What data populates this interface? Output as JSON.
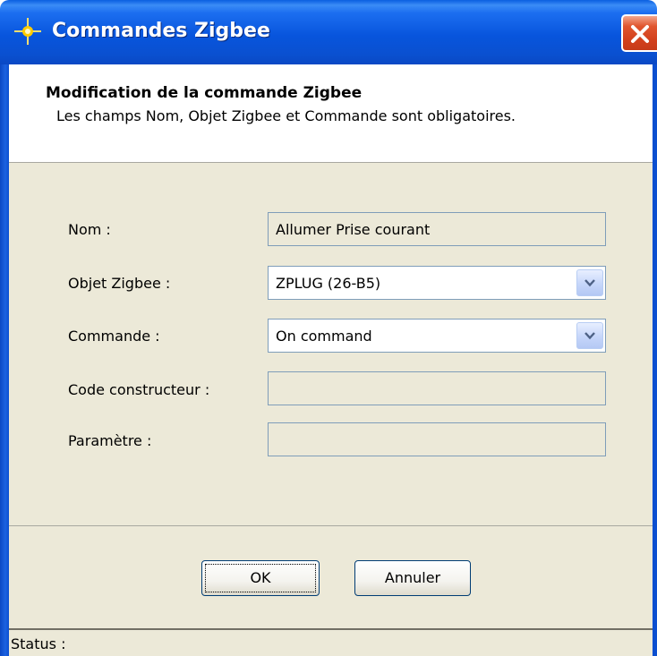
{
  "window": {
    "title": "Commandes Zigbee",
    "icon": "zigbee-star-icon",
    "close_icon": "close-icon"
  },
  "header": {
    "title": "Modification de la commande Zigbee",
    "subtitle": "Les champs Nom, Objet Zigbee et Commande sont obligatoires."
  },
  "form": {
    "fields": [
      {
        "label": "Nom :",
        "value": "Allumer Prise courant",
        "type": "text"
      },
      {
        "label": "Objet Zigbee :",
        "value": "ZPLUG (26-B5)",
        "type": "select"
      },
      {
        "label": "Commande :",
        "value": "On command",
        "type": "select"
      },
      {
        "label": "Code constructeur :",
        "value": "",
        "type": "text"
      },
      {
        "label": "Paramètre :",
        "value": "",
        "type": "text"
      }
    ]
  },
  "buttons": {
    "ok_label": "OK",
    "cancel_label": "Annuler"
  },
  "status": {
    "text": "Status :"
  },
  "colors": {
    "titlebar": "#0855dd",
    "dialog_bg": "#ece9d8",
    "field_border": "#7f9db9",
    "close_button": "#d2401c"
  }
}
